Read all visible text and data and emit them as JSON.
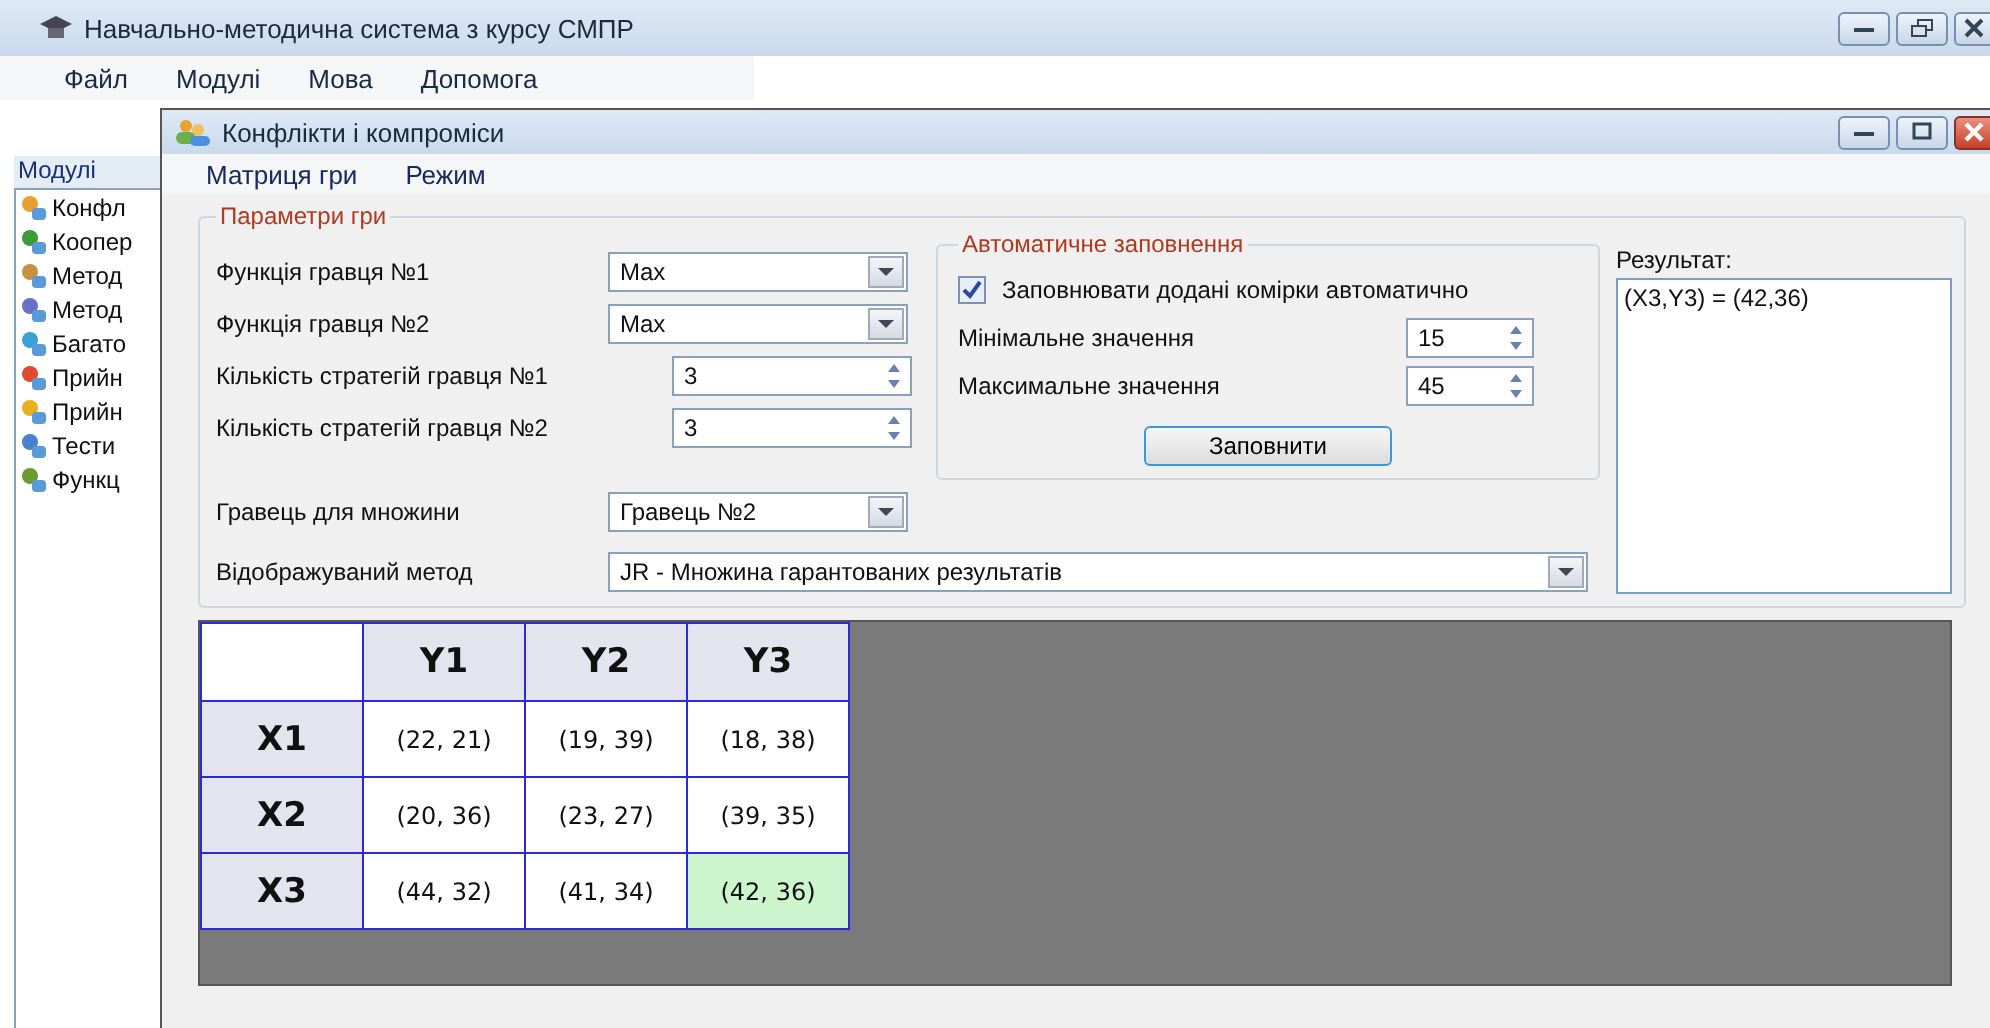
{
  "main_window": {
    "title": "Навчально-методична система з курсу СМПР",
    "menu": [
      "Файл",
      "Модулі",
      "Мова",
      "Допомога"
    ]
  },
  "sidebar": {
    "title": "Модулі",
    "items": [
      {
        "label": "Конфл"
      },
      {
        "label": "Коопер"
      },
      {
        "label": "Метод"
      },
      {
        "label": "Метод"
      },
      {
        "label": "Багато"
      },
      {
        "label": "Прийн"
      },
      {
        "label": "Прийн"
      },
      {
        "label": "Тести"
      },
      {
        "label": "Функц"
      }
    ]
  },
  "child_window": {
    "title": "Конфлікти і компроміси",
    "menu": [
      "Матриця гри",
      "Режим"
    ],
    "params": {
      "title": "Параметри гри",
      "fields": [
        {
          "kind": "dropdown",
          "label": "Функція гравця №1",
          "value": "Max"
        },
        {
          "kind": "dropdown",
          "label": "Функція гравця №2",
          "value": "Max"
        },
        {
          "kind": "spinner",
          "label": "Кількість стратегій гравця №1",
          "value": "3"
        },
        {
          "kind": "spinner",
          "label": "Кількість стратегій гравця №2",
          "value": "3"
        },
        {
          "kind": "dropdown",
          "label": "Гравець для множини",
          "value": "Гравець №2"
        }
      ],
      "method": {
        "label": "Відображуваний метод",
        "value": "JR - Множина гарантованих результатів"
      }
    },
    "autofill": {
      "title": "Автоматичне заповнення",
      "checkbox": {
        "label": "Заповнювати додані комірки автоматично",
        "checked": true
      },
      "fields": [
        {
          "label": "Мінімальне значення",
          "value": "15"
        },
        {
          "label": "Максимальне значення",
          "value": "45"
        }
      ],
      "button": "Заповнити"
    },
    "result": {
      "label": "Результат:",
      "value": "(X3,Y3) = (42,36)"
    },
    "matrix": {
      "columns": [
        "Y1",
        "Y2",
        "Y3"
      ],
      "rows": [
        {
          "label": "X1",
          "cells": [
            {
              "value": "(22, 21)",
              "selected": false
            },
            {
              "value": "(19, 39)",
              "selected": false
            },
            {
              "value": "(18, 38)",
              "selected": false
            }
          ]
        },
        {
          "label": "X2",
          "cells": [
            {
              "value": "(20, 36)",
              "selected": false
            },
            {
              "value": "(23, 27)",
              "selected": false
            },
            {
              "value": "(39, 35)",
              "selected": false
            }
          ]
        },
        {
          "label": "X3",
          "cells": [
            {
              "value": "(44, 32)",
              "selected": false
            },
            {
              "value": "(41, 34)",
              "selected": false
            },
            {
              "value": "(42, 36)",
              "selected": true
            }
          ]
        }
      ]
    }
  }
}
